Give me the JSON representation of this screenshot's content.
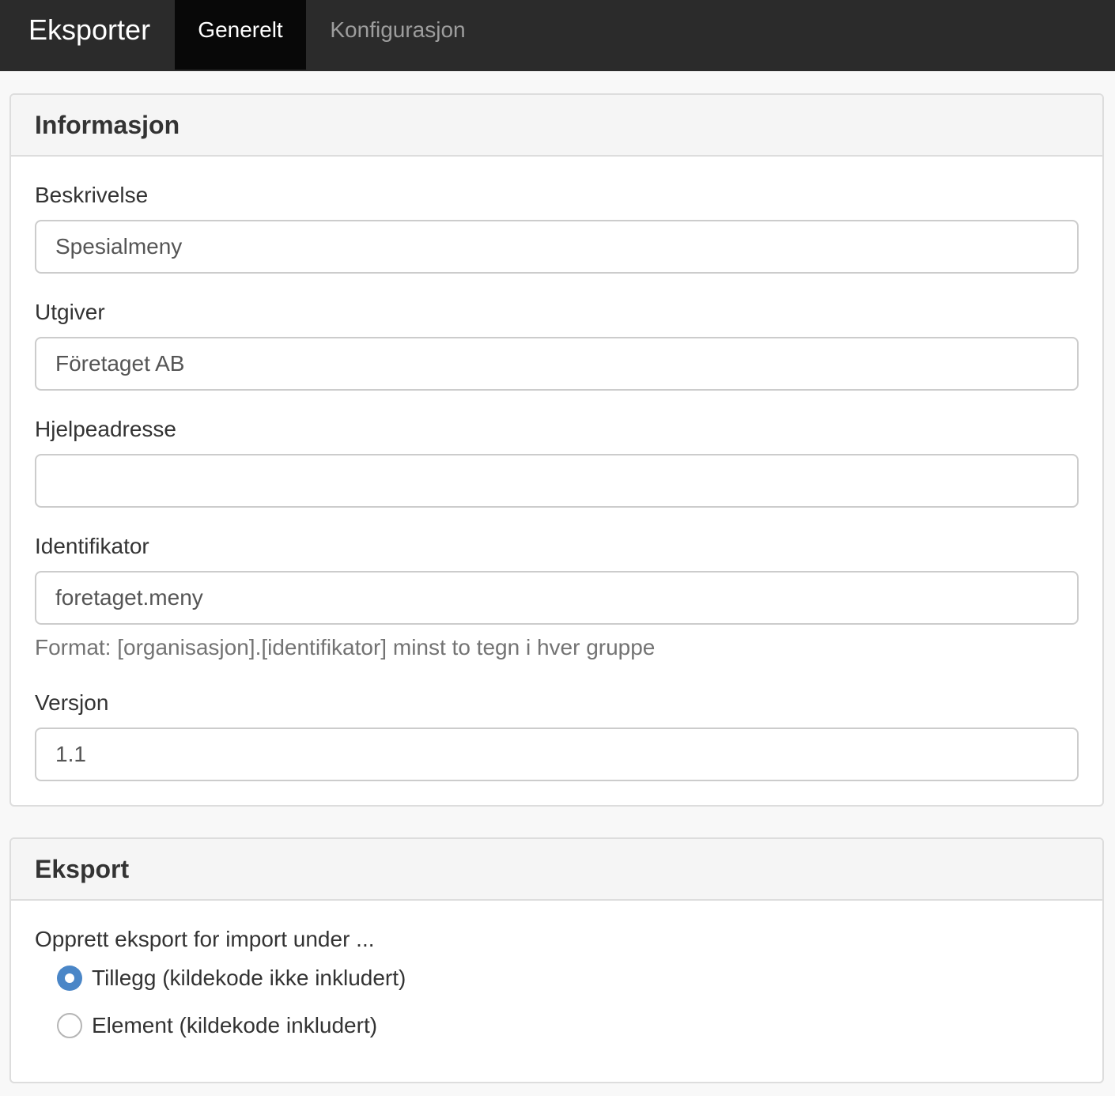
{
  "navbar": {
    "brand": "Eksporter",
    "tabs": [
      {
        "label": "Generelt",
        "active": true
      },
      {
        "label": "Konfigurasjon",
        "active": false
      }
    ]
  },
  "info_panel": {
    "title": "Informasjon",
    "fields": {
      "beskrivelse": {
        "label": "Beskrivelse",
        "value": "Spesialmeny"
      },
      "utgiver": {
        "label": "Utgiver",
        "value": "Företaget AB"
      },
      "hjelpeadresse": {
        "label": "Hjelpeadresse",
        "value": ""
      },
      "identifikator": {
        "label": "Identifikator",
        "value": "foretaget.meny",
        "help": "Format: [organisasjon].[identifikator] minst to tegn i hver gruppe"
      },
      "versjon": {
        "label": "Versjon",
        "value": "1.1"
      }
    }
  },
  "export_panel": {
    "title": "Eksport",
    "prompt": "Opprett eksport for import under ...",
    "options": [
      {
        "label": "Tillegg (kildekode ikke inkludert)",
        "checked": true
      },
      {
        "label": "Element (kildekode inkludert)",
        "checked": false
      }
    ]
  },
  "colors": {
    "navbar_bg": "#2b2b2b",
    "active_tab_bg": "#080808",
    "radio_checked": "#4a86c7"
  }
}
